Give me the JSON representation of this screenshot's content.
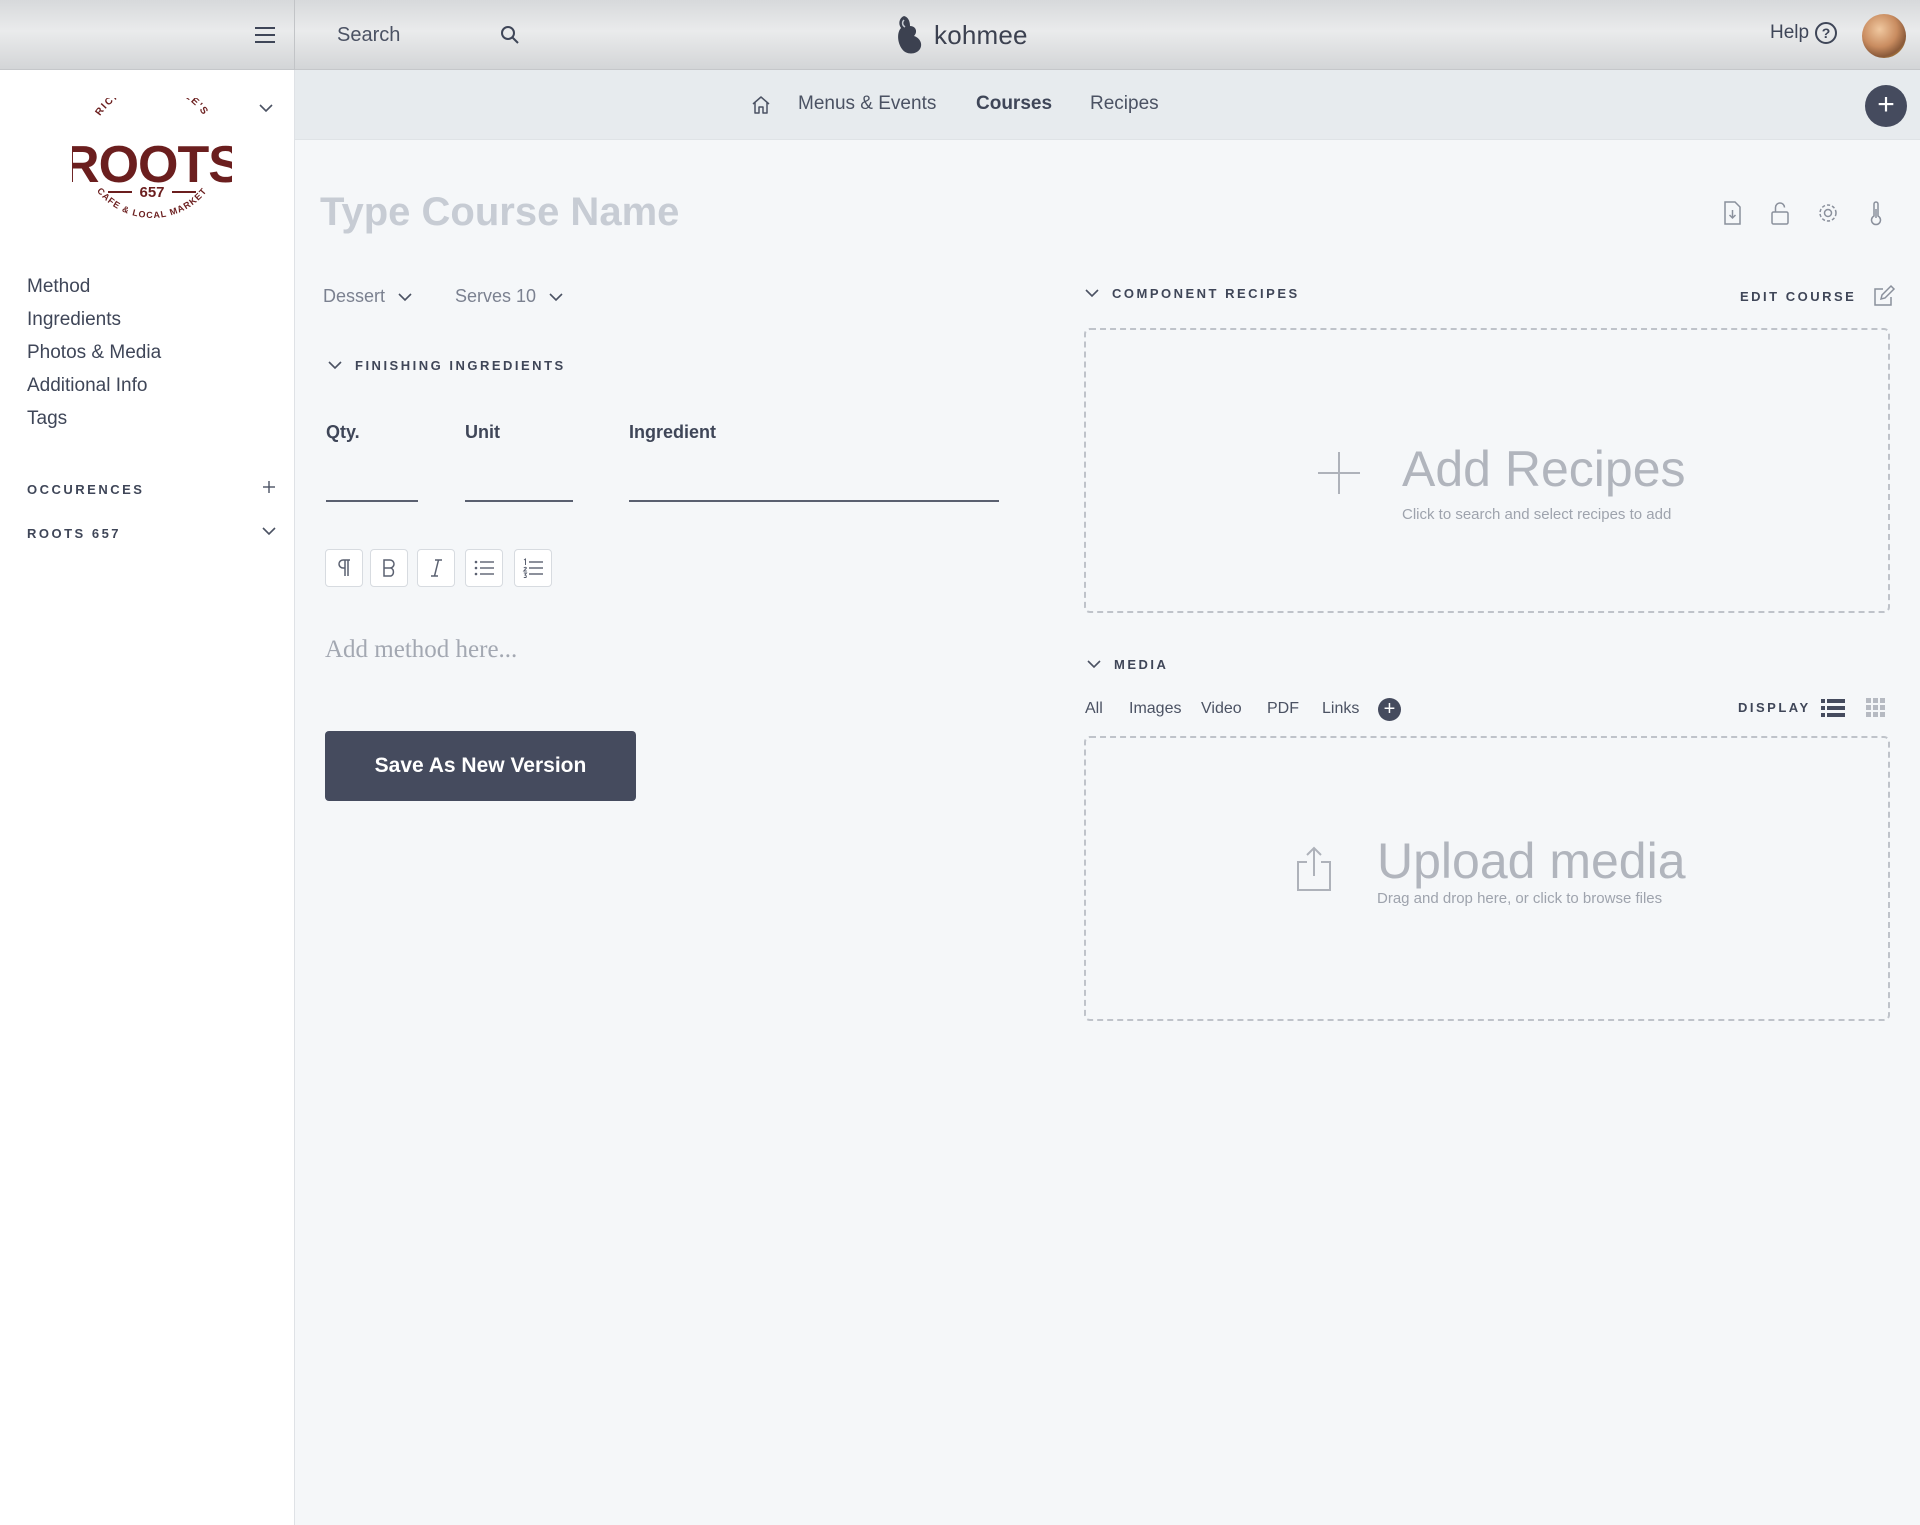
{
  "topbar": {
    "search_label": "Search",
    "brand_name": "kohmee",
    "help_label": "Help",
    "help_glyph": "?"
  },
  "sidebar": {
    "logo": {
      "top_arc": "RICH ROSENDALE'S",
      "name": "ROOTS",
      "number": "657",
      "bottom_arc": "CAFE & LOCAL MARKET",
      "color": "#6b1e1e"
    },
    "nav": [
      {
        "label": "Method"
      },
      {
        "label": "Ingredients"
      },
      {
        "label": "Photos & Media"
      },
      {
        "label": "Additional Info"
      },
      {
        "label": "Tags"
      }
    ],
    "sections": {
      "occurences": "OCCURENCES",
      "location": "ROOTS 657"
    }
  },
  "tabs": {
    "items": [
      {
        "label": "Menus & Events"
      },
      {
        "label": "Courses"
      },
      {
        "label": "Recipes"
      }
    ],
    "active": "Courses",
    "add_glyph": "+"
  },
  "course": {
    "name_placeholder": "Type Course Name",
    "category": "Dessert",
    "serves": "Serves 10"
  },
  "ingredients": {
    "section_title": "FINISHING INGREDIENTS",
    "columns": {
      "qty": "Qty.",
      "unit": "Unit",
      "ingredient": "Ingredient"
    }
  },
  "editor": {
    "method_placeholder": "Add method here..."
  },
  "actions": {
    "save_label": "Save As New Version"
  },
  "component_recipes": {
    "section_title": "COMPONENT RECIPES",
    "edit_label": "EDIT COURSE",
    "dropzone_title": "Add Recipes",
    "dropzone_sub": "Click to search and select recipes to add"
  },
  "media": {
    "section_title": "MEDIA",
    "filters": [
      "All",
      "Images",
      "Video",
      "PDF",
      "Links"
    ],
    "add_glyph": "+",
    "display_label": "DISPLAY",
    "dropzone_title": "Upload media",
    "dropzone_sub": "Drag and drop here, or click to browse files"
  },
  "colors": {
    "accent": "#454b5e",
    "background": "#f5f7f9",
    "placeholder": "#c7ccd4"
  },
  "icons": [
    "menu-icon",
    "search-icon",
    "kohmee-logo-icon",
    "help-icon",
    "home-icon",
    "plus-icon",
    "export-icon",
    "lock-icon",
    "gear-icon",
    "thermometer-icon",
    "chevron-down-icon",
    "paragraph-icon",
    "bold-icon",
    "italic-icon",
    "bullet-list-icon",
    "numbered-list-icon",
    "edit-icon",
    "upload-icon",
    "list-view-icon",
    "grid-view-icon"
  ]
}
